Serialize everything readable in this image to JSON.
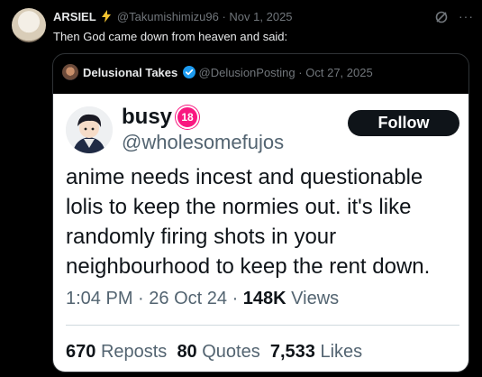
{
  "outer_tweet": {
    "display_name": "ARSIEL",
    "badge_icon": "lightning-icon",
    "handle": "@Takumishimizu96",
    "separator": "·",
    "date": "Nov 1, 2025",
    "text": "Then God came down from heaven and said:",
    "more_label": "···"
  },
  "quote": {
    "display_name": "Delusional Takes",
    "handle": "@DelusionPosting",
    "separator": "·",
    "date": "Oct 27, 2025"
  },
  "embedded_tweet": {
    "display_name": "busy",
    "badge": "18",
    "handle": "@wholesomefujos",
    "follow_label": "Follow",
    "body": "anime needs incest and questionable lolis to keep the normies out. it's like randomly firing shots in your neighbourhood to keep the rent down.",
    "time": "1:04 PM",
    "meta_sep": "·",
    "date": "26 Oct 24",
    "views_count": "148K",
    "views_label": "Views",
    "reposts_count": "670",
    "reposts_label": "Reposts",
    "quotes_count": "80",
    "quotes_label": "Quotes",
    "likes_count": "7,533",
    "likes_label": "Likes"
  },
  "colors": {
    "background": "#000000",
    "muted": "#71767b",
    "verified_blue": "#1d9bf0",
    "lightning_yellow": "#f4c430",
    "badge_pink": "#f91880"
  }
}
